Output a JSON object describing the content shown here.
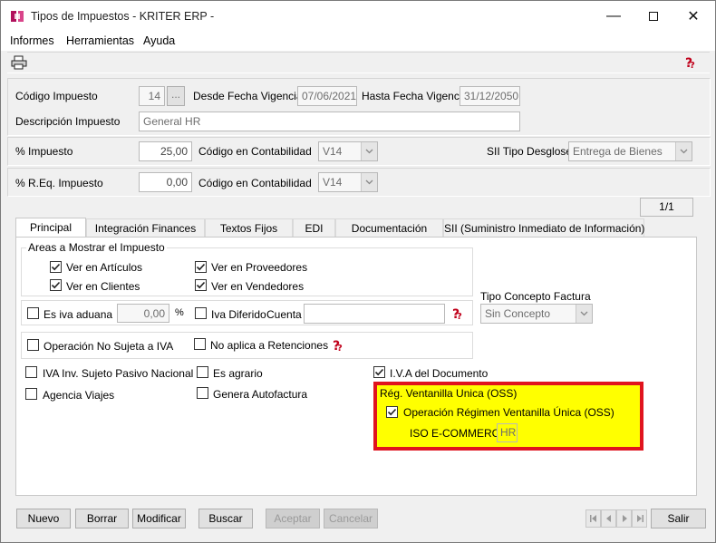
{
  "window": {
    "title": "Tipos de Impuestos - KRITER ERP -"
  },
  "menu": [
    "Informes",
    "Herramientas",
    "Ayuda"
  ],
  "form": {
    "codigo_label": "Código Impuesto",
    "codigo_value": "14",
    "lookup_label": "...",
    "desde_label": "Desde Fecha Vigencia",
    "desde_value": "07/06/2021",
    "hasta_label": "Hasta Fecha Vigencia",
    "hasta_value": "31/12/2050",
    "descripcion_label": "Descripción Impuesto",
    "descripcion_value": "General HR",
    "pct_label": "% Impuesto",
    "pct_value": "25,00",
    "cod_contab_label": "Código en Contabilidad",
    "cod_contab_value": "V14",
    "sii_label": "SII Tipo Desglose",
    "sii_value": "Entrega de Bienes",
    "req_label": "% R.Eq. Impuesto",
    "req_value": "0,00",
    "cod_contab2_label": "Código en Contabilidad",
    "cod_contab2_value": "V14",
    "page_indicator": "1/1"
  },
  "tabs": [
    "Principal",
    "Integración Finances",
    "Textos Fijos",
    "EDI",
    "Documentación",
    "SII (Suministro Inmediato de Información)"
  ],
  "principal": {
    "areas_title": "Areas a Mostrar el Impuesto",
    "ver_articulos": "Ver en Artículos",
    "ver_proveedores": "Ver en Proveedores",
    "ver_clientes": "Ver en Clientes",
    "ver_vendedores": "Ver en Vendedores",
    "es_iva_aduana": "Es iva aduana",
    "aduana_value": "0,00",
    "pct_symbol": "%",
    "iva_diferido": "Iva Diferido",
    "cuenta_label": "Cuenta",
    "cuenta_value": "",
    "tipo_concepto_label": "Tipo Concepto Factura",
    "tipo_concepto_value": "Sin Concepto",
    "no_sujeta": "Operación No Sujeta a IVA",
    "no_aplica_ret": "No aplica a Retenciones",
    "iva_inv": "IVA Inv. Sujeto Pasivo Nacional",
    "es_agrario": "Es agrario",
    "iva_documento": "I.V.A del Documento",
    "agencia_viajes": "Agencia Viajes",
    "genera_autofactura": "Genera Autofactura",
    "oss_title": "Rég. Ventanilla Unica (OSS)",
    "oss_operacion": "Operación Régimen Ventanilla Única (OSS)",
    "iso_label": "ISO E-COMMERCE",
    "iso_value": "HR"
  },
  "checks": {
    "ver_articulos": true,
    "ver_proveedores": true,
    "ver_clientes": true,
    "ver_vendedores": true,
    "es_iva_aduana": false,
    "iva_diferido": false,
    "no_sujeta": false,
    "no_aplica_ret": false,
    "iva_inv": false,
    "es_agrario": false,
    "iva_documento": true,
    "agencia_viajes": false,
    "genera_autofactura": false,
    "oss_operacion": true
  },
  "buttons": {
    "nuevo": "Nuevo",
    "borrar": "Borrar",
    "modificar": "Modificar",
    "buscar": "Buscar",
    "aceptar": "Aceptar",
    "cancelar": "Cancelar",
    "salir": "Salir"
  },
  "colors": {
    "highlight_fill": "#ffff00",
    "highlight_border": "#e0141e",
    "help_icon": "#c0001a"
  },
  "icons": [
    "app-icon",
    "minimize-icon",
    "maximize-icon",
    "close-icon",
    "print-icon",
    "help-icon",
    "chevron-down-icon",
    "first-record-icon",
    "prev-record-icon",
    "next-record-icon",
    "last-record-icon"
  ]
}
